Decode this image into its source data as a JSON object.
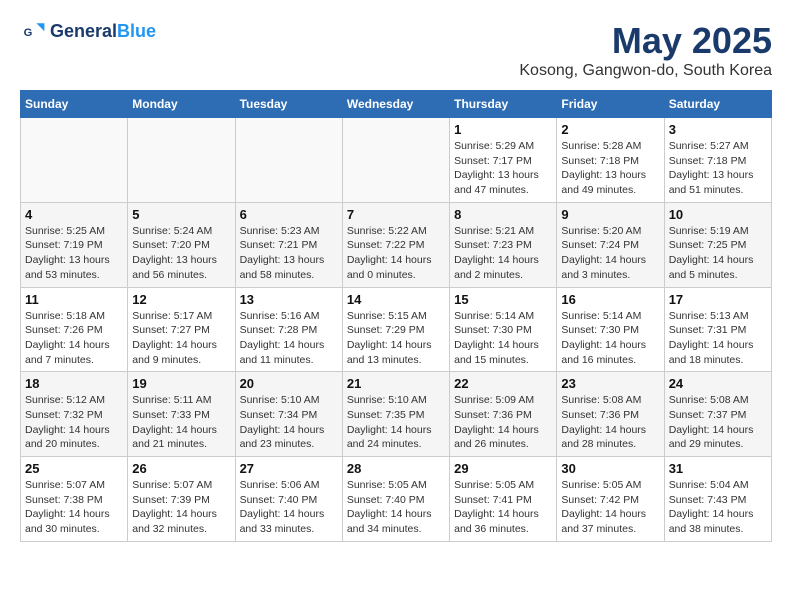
{
  "logo": {
    "line1": "General",
    "line2": "Blue"
  },
  "title": "May 2025",
  "subtitle": "Kosong, Gangwon-do, South Korea",
  "days_of_week": [
    "Sunday",
    "Monday",
    "Tuesday",
    "Wednesday",
    "Thursday",
    "Friday",
    "Saturday"
  ],
  "weeks": [
    [
      {
        "num": "",
        "detail": ""
      },
      {
        "num": "",
        "detail": ""
      },
      {
        "num": "",
        "detail": ""
      },
      {
        "num": "",
        "detail": ""
      },
      {
        "num": "1",
        "detail": "Sunrise: 5:29 AM\nSunset: 7:17 PM\nDaylight: 13 hours\nand 47 minutes."
      },
      {
        "num": "2",
        "detail": "Sunrise: 5:28 AM\nSunset: 7:18 PM\nDaylight: 13 hours\nand 49 minutes."
      },
      {
        "num": "3",
        "detail": "Sunrise: 5:27 AM\nSunset: 7:18 PM\nDaylight: 13 hours\nand 51 minutes."
      }
    ],
    [
      {
        "num": "4",
        "detail": "Sunrise: 5:25 AM\nSunset: 7:19 PM\nDaylight: 13 hours\nand 53 minutes."
      },
      {
        "num": "5",
        "detail": "Sunrise: 5:24 AM\nSunset: 7:20 PM\nDaylight: 13 hours\nand 56 minutes."
      },
      {
        "num": "6",
        "detail": "Sunrise: 5:23 AM\nSunset: 7:21 PM\nDaylight: 13 hours\nand 58 minutes."
      },
      {
        "num": "7",
        "detail": "Sunrise: 5:22 AM\nSunset: 7:22 PM\nDaylight: 14 hours\nand 0 minutes."
      },
      {
        "num": "8",
        "detail": "Sunrise: 5:21 AM\nSunset: 7:23 PM\nDaylight: 14 hours\nand 2 minutes."
      },
      {
        "num": "9",
        "detail": "Sunrise: 5:20 AM\nSunset: 7:24 PM\nDaylight: 14 hours\nand 3 minutes."
      },
      {
        "num": "10",
        "detail": "Sunrise: 5:19 AM\nSunset: 7:25 PM\nDaylight: 14 hours\nand 5 minutes."
      }
    ],
    [
      {
        "num": "11",
        "detail": "Sunrise: 5:18 AM\nSunset: 7:26 PM\nDaylight: 14 hours\nand 7 minutes."
      },
      {
        "num": "12",
        "detail": "Sunrise: 5:17 AM\nSunset: 7:27 PM\nDaylight: 14 hours\nand 9 minutes."
      },
      {
        "num": "13",
        "detail": "Sunrise: 5:16 AM\nSunset: 7:28 PM\nDaylight: 14 hours\nand 11 minutes."
      },
      {
        "num": "14",
        "detail": "Sunrise: 5:15 AM\nSunset: 7:29 PM\nDaylight: 14 hours\nand 13 minutes."
      },
      {
        "num": "15",
        "detail": "Sunrise: 5:14 AM\nSunset: 7:30 PM\nDaylight: 14 hours\nand 15 minutes."
      },
      {
        "num": "16",
        "detail": "Sunrise: 5:14 AM\nSunset: 7:30 PM\nDaylight: 14 hours\nand 16 minutes."
      },
      {
        "num": "17",
        "detail": "Sunrise: 5:13 AM\nSunset: 7:31 PM\nDaylight: 14 hours\nand 18 minutes."
      }
    ],
    [
      {
        "num": "18",
        "detail": "Sunrise: 5:12 AM\nSunset: 7:32 PM\nDaylight: 14 hours\nand 20 minutes."
      },
      {
        "num": "19",
        "detail": "Sunrise: 5:11 AM\nSunset: 7:33 PM\nDaylight: 14 hours\nand 21 minutes."
      },
      {
        "num": "20",
        "detail": "Sunrise: 5:10 AM\nSunset: 7:34 PM\nDaylight: 14 hours\nand 23 minutes."
      },
      {
        "num": "21",
        "detail": "Sunrise: 5:10 AM\nSunset: 7:35 PM\nDaylight: 14 hours\nand 24 minutes."
      },
      {
        "num": "22",
        "detail": "Sunrise: 5:09 AM\nSunset: 7:36 PM\nDaylight: 14 hours\nand 26 minutes."
      },
      {
        "num": "23",
        "detail": "Sunrise: 5:08 AM\nSunset: 7:36 PM\nDaylight: 14 hours\nand 28 minutes."
      },
      {
        "num": "24",
        "detail": "Sunrise: 5:08 AM\nSunset: 7:37 PM\nDaylight: 14 hours\nand 29 minutes."
      }
    ],
    [
      {
        "num": "25",
        "detail": "Sunrise: 5:07 AM\nSunset: 7:38 PM\nDaylight: 14 hours\nand 30 minutes."
      },
      {
        "num": "26",
        "detail": "Sunrise: 5:07 AM\nSunset: 7:39 PM\nDaylight: 14 hours\nand 32 minutes."
      },
      {
        "num": "27",
        "detail": "Sunrise: 5:06 AM\nSunset: 7:40 PM\nDaylight: 14 hours\nand 33 minutes."
      },
      {
        "num": "28",
        "detail": "Sunrise: 5:05 AM\nSunset: 7:40 PM\nDaylight: 14 hours\nand 34 minutes."
      },
      {
        "num": "29",
        "detail": "Sunrise: 5:05 AM\nSunset: 7:41 PM\nDaylight: 14 hours\nand 36 minutes."
      },
      {
        "num": "30",
        "detail": "Sunrise: 5:05 AM\nSunset: 7:42 PM\nDaylight: 14 hours\nand 37 minutes."
      },
      {
        "num": "31",
        "detail": "Sunrise: 5:04 AM\nSunset: 7:43 PM\nDaylight: 14 hours\nand 38 minutes."
      }
    ]
  ]
}
